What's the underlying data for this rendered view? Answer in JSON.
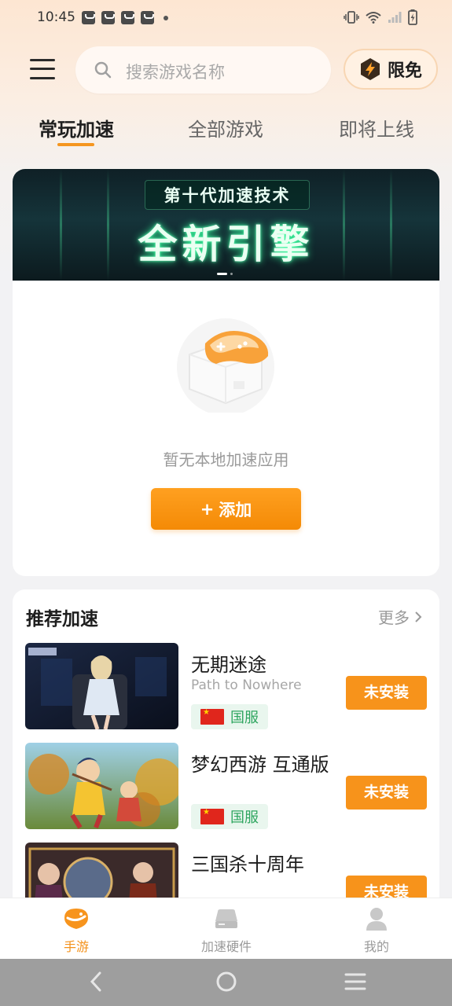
{
  "status_bar": {
    "time": "10:45"
  },
  "search": {
    "placeholder": "搜索游戏名称"
  },
  "header": {
    "free_label": "限免"
  },
  "tabs": [
    {
      "label": "常玩加速",
      "active": true
    },
    {
      "label": "全部游戏",
      "active": false
    },
    {
      "label": "即将上线",
      "active": false
    }
  ],
  "banner": {
    "subtitle": "第十代加速技术",
    "title": "全新引擎",
    "slide_index": 1,
    "slide_count": 2
  },
  "empty_state": {
    "text": "暂无本地加速应用",
    "add_button": "添加"
  },
  "recommend": {
    "title": "推荐加速",
    "more_label": "更多",
    "games": [
      {
        "name": "无期迷途",
        "en_name": "Path to Nowhere",
        "region": "国服",
        "button": "未安装"
      },
      {
        "name": "梦幻西游 互通版",
        "en_name": "",
        "region": "国服",
        "button": "未安装"
      },
      {
        "name": "三国杀十周年",
        "en_name": "",
        "region": "",
        "button": "未安装"
      }
    ]
  },
  "bottom_nav": [
    {
      "label": "手游",
      "icon": "gamepad-face-icon",
      "active": true
    },
    {
      "label": "加速硬件",
      "icon": "router-icon",
      "active": false
    },
    {
      "label": "我的",
      "icon": "user-icon",
      "active": false
    }
  ],
  "colors": {
    "accent": "#F7931B",
    "region_green": "#2EA55F",
    "banner_glow": "#34FF9E"
  }
}
